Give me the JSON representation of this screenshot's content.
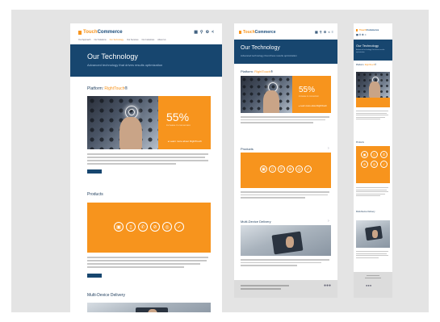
{
  "brand": {
    "part1": "Touch",
    "part2": "Commerce"
  },
  "header_icons": [
    "grid-icon",
    "search-icon",
    "settings-icon",
    "share-icon"
  ],
  "hero": {
    "title": "Our Technology",
    "subtitle": "Advanced technology that drives results optimization"
  },
  "nav": [
    "Our Approach",
    "Our Solutions",
    "Our Technology",
    "Our Services",
    "Our Industries",
    "About Us"
  ],
  "sections": {
    "platform": {
      "prefix": "Platform: ",
      "highlight": "RightTouch",
      "suffix": "®"
    },
    "stat": {
      "value": "55%",
      "caption": "increase in conversion"
    },
    "learn_more": "▸ Learn more about RightTouch",
    "products": "Products",
    "multi_device": "Multi-Device Delivery"
  },
  "colors": {
    "brand_orange": "#f7941d",
    "navy": "#17466f"
  }
}
